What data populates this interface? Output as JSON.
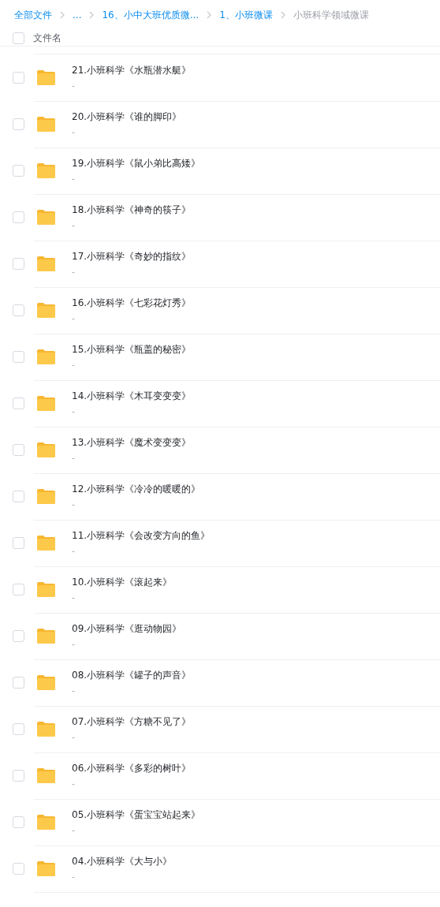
{
  "breadcrumb": [
    {
      "label": "全部文件",
      "selected": false
    },
    {
      "label": "...",
      "selected": false
    },
    {
      "label": "16、小中大班优质微...",
      "selected": false
    },
    {
      "label": "1、小班微课",
      "selected": false
    },
    {
      "label": "小班科学领域微课",
      "selected": true
    }
  ],
  "header": {
    "label": "文件名",
    "checked": false
  },
  "files": [
    {
      "name": "21.小班科学《水瓶潜水艇》",
      "meta": "-",
      "checked": false
    },
    {
      "name": "20.小班科学《谁的脚印》",
      "meta": "-",
      "checked": false
    },
    {
      "name": "19.小班科学《鼠小弟比高矮》",
      "meta": "-",
      "checked": false
    },
    {
      "name": "18.小班科学《神奇的筷子》",
      "meta": "-",
      "checked": false
    },
    {
      "name": "17.小班科学《奇妙的指纹》",
      "meta": "-",
      "checked": false
    },
    {
      "name": "16.小班科学《七彩花灯秀》",
      "meta": "-",
      "checked": false
    },
    {
      "name": "15.小班科学《瓶盖的秘密》",
      "meta": "-",
      "checked": false
    },
    {
      "name": "14.小班科学《木耳变变变》",
      "meta": "-",
      "checked": false
    },
    {
      "name": "13.小班科学《魔术变变变》",
      "meta": "-",
      "checked": false
    },
    {
      "name": "12.小班科学《冷冷的暖暖的》",
      "meta": "-",
      "checked": false
    },
    {
      "name": "11.小班科学《会改变方向的鱼》",
      "meta": "-",
      "checked": false
    },
    {
      "name": "10.小班科学《滚起来》",
      "meta": "-",
      "checked": false
    },
    {
      "name": "09.小班科学《逛动物园》",
      "meta": "-",
      "checked": false
    },
    {
      "name": "08.小班科学《罐子的声音》",
      "meta": "-",
      "checked": false
    },
    {
      "name": "07.小班科学《方糖不见了》",
      "meta": "-",
      "checked": false
    },
    {
      "name": "06.小班科学《多彩的树叶》",
      "meta": "-",
      "checked": false
    },
    {
      "name": "05.小班科学《蛋宝宝站起来》",
      "meta": "-",
      "checked": false
    },
    {
      "name": "04.小班科学《大与小》",
      "meta": "-",
      "checked": false
    }
  ]
}
